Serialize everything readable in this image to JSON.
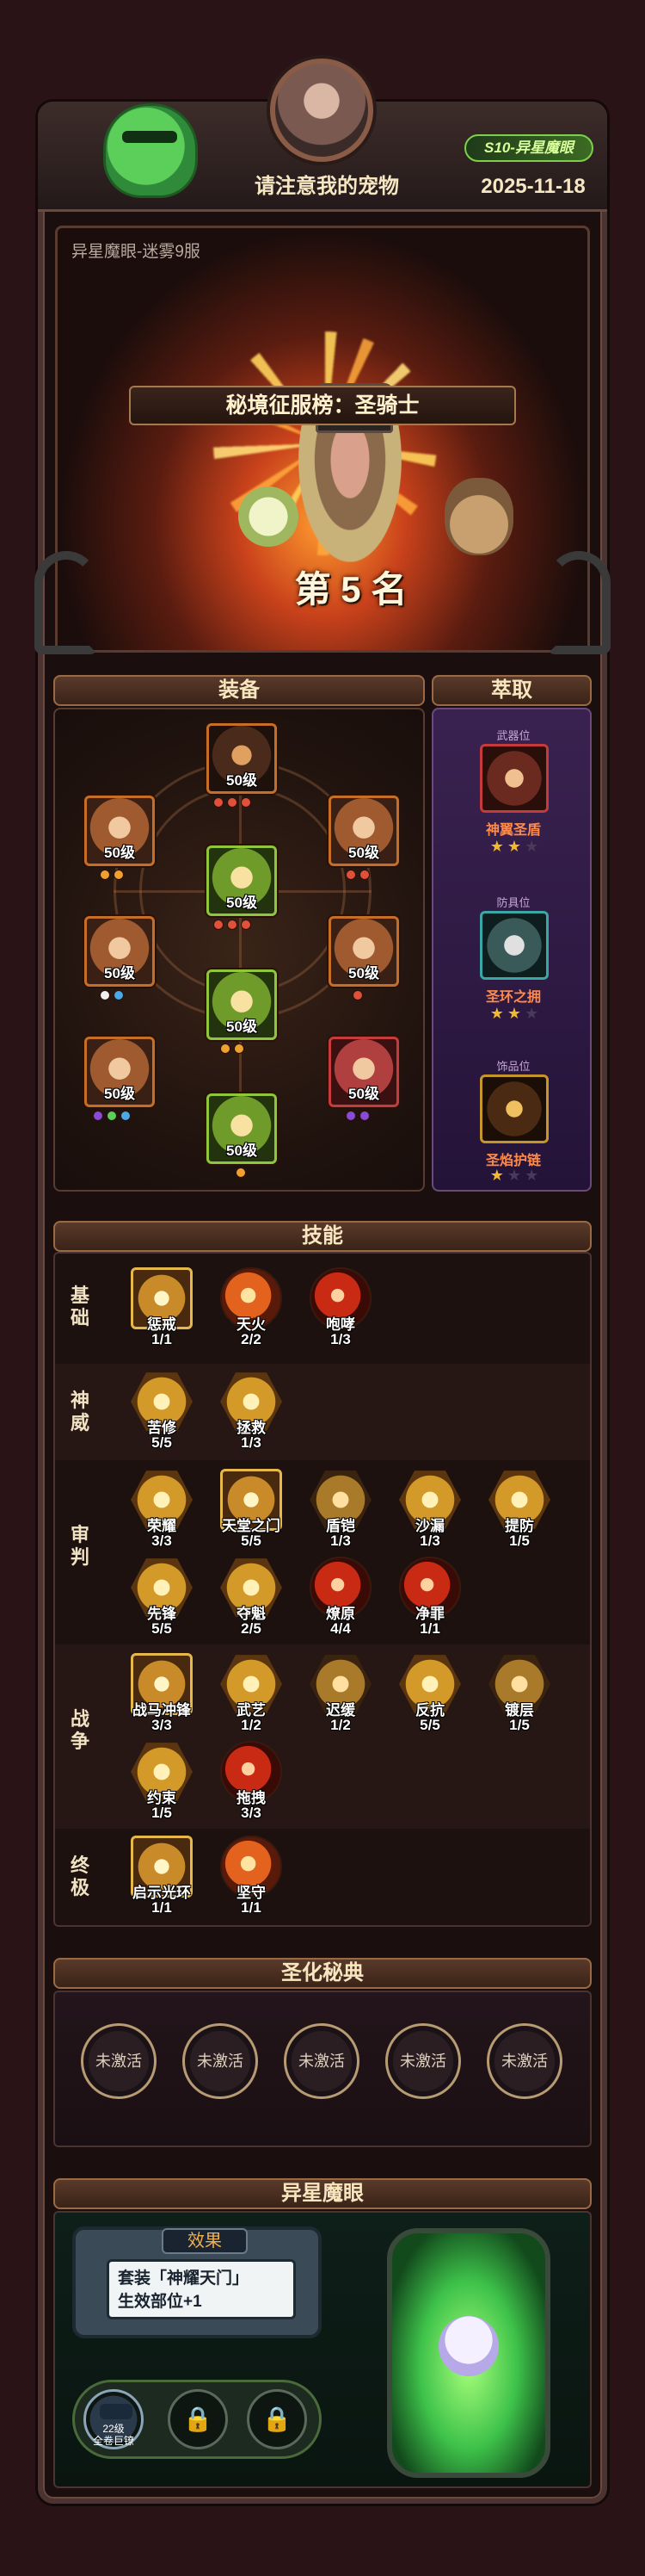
{
  "header": {
    "title": "请注意我的宠物",
    "season_badge": "S10-异星魔眼",
    "date": "2025-11-18"
  },
  "hero": {
    "mode_label": "异星魔眼-迷雾9服",
    "rank": "第 5 名",
    "ranking_title": "秘境征服榜：圣骑士"
  },
  "equipment": {
    "title": "装备",
    "slots": [
      {
        "level": "50级",
        "gems": [
          "#e0503a",
          "#e0503a",
          "#e0503a"
        ]
      },
      {
        "level": "50级",
        "gems": [
          "#f0a030",
          "#f0a030"
        ]
      },
      {
        "level": "50级",
        "gems": [
          "#e0503a",
          "#e0503a"
        ]
      },
      {
        "level": "50级",
        "gems": [
          "#e0503a",
          "#e0503a",
          "#e0503a"
        ]
      },
      {
        "level": "50级",
        "gems": [
          "#f0f0f0",
          "#4aa8e8"
        ]
      },
      {
        "level": "50级",
        "gems": [
          "#e0503a"
        ]
      },
      {
        "level": "50级",
        "gems": [
          "#f0a030",
          "#f0a030"
        ]
      },
      {
        "level": "50级",
        "gems": [
          "#8a4ad8",
          "#5ad05a",
          "#4aa8e8"
        ]
      },
      {
        "level": "50级",
        "gems": [
          "#8a4ad8",
          "#8a4ad8"
        ]
      },
      {
        "level": "50级",
        "gems": [
          "#f0a030"
        ]
      }
    ]
  },
  "extract": {
    "title": "萃取",
    "items": [
      {
        "slot_label": "武器位",
        "name": "神翼圣盾",
        "stars": 2,
        "max_stars": 3
      },
      {
        "slot_label": "防具位",
        "name": "圣环之拥",
        "stars": 2,
        "max_stars": 3
      },
      {
        "slot_label": "饰品位",
        "name": "圣焰护链",
        "stars": 1,
        "max_stars": 3
      }
    ]
  },
  "skills": {
    "title": "技能",
    "categories": [
      {
        "name": "基础",
        "skills": [
          {
            "name": "惩戒",
            "count": "1/1"
          },
          {
            "name": "天火",
            "count": "2/2"
          },
          {
            "name": "咆哮",
            "count": "1/3"
          }
        ]
      },
      {
        "name": "神威",
        "skills": [
          {
            "name": "苦修",
            "count": "5/5"
          },
          {
            "name": "拯救",
            "count": "1/3"
          }
        ]
      },
      {
        "name": "审判",
        "skills": [
          {
            "name": "荣耀",
            "count": "3/3"
          },
          {
            "name": "天堂之门",
            "count": "5/5"
          },
          {
            "name": "盾铠",
            "count": "1/3"
          },
          {
            "name": "沙漏",
            "count": "1/3"
          },
          {
            "name": "提防",
            "count": "1/5"
          },
          {
            "name": "先锋",
            "count": "5/5"
          },
          {
            "name": "夺魁",
            "count": "2/5"
          },
          {
            "name": "燎原",
            "count": "4/4"
          },
          {
            "name": "净罪",
            "count": "1/1"
          }
        ]
      },
      {
        "name": "战争",
        "skills": [
          {
            "name": "战马冲锋",
            "count": "3/3"
          },
          {
            "name": "武艺",
            "count": "1/2"
          },
          {
            "name": "迟缓",
            "count": "1/2"
          },
          {
            "name": "反抗",
            "count": "5/5"
          },
          {
            "name": "镀层",
            "count": "1/5"
          },
          {
            "name": "约束",
            "count": "1/5"
          },
          {
            "name": "拖拽",
            "count": "3/3"
          }
        ]
      },
      {
        "name": "终极",
        "skills": [
          {
            "name": "启示光环",
            "count": "1/1"
          },
          {
            "name": "坚守",
            "count": "1/1"
          }
        ]
      }
    ]
  },
  "codex": {
    "title": "圣化秘典",
    "slots": [
      "未激活",
      "未激活",
      "未激活",
      "未激活",
      "未激活"
    ]
  },
  "alien_eye": {
    "title": "异星魔眼",
    "effect_label": "效果",
    "effect_line1": "套装「神耀天门」",
    "effect_line2": "生效部位+1",
    "unit_level": "22级",
    "unit_sub": "全卷巨镣",
    "lock_icon": "🔒"
  },
  "colors": {
    "gold": "#e6b84a",
    "orange_rarity": "#c56e28",
    "green_rarity": "#8fc63c",
    "red_rarity": "#c63c3c",
    "extract_name": "#ff8a4a"
  }
}
